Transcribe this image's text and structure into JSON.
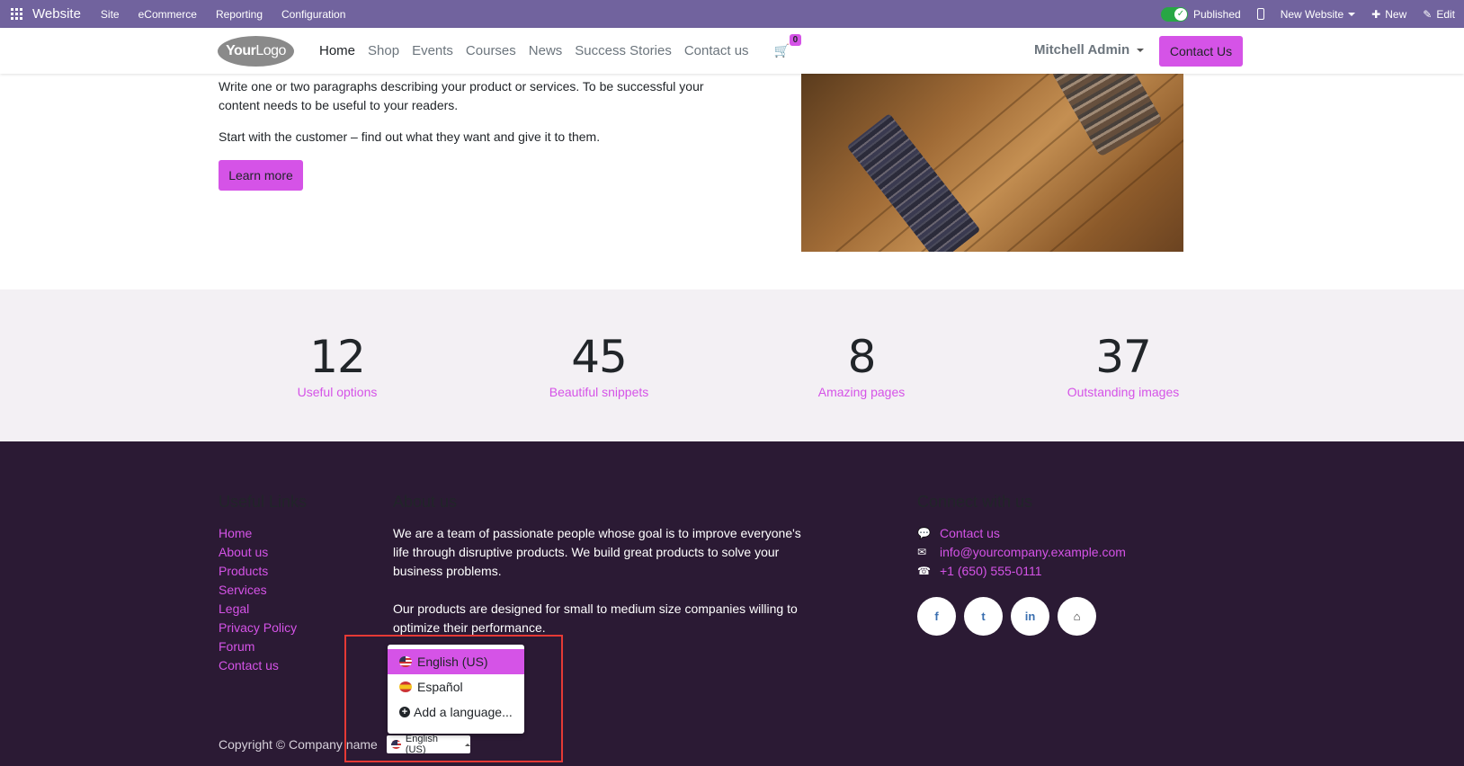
{
  "adminbar": {
    "brand": "Website",
    "menu": [
      "Site",
      "eCommerce",
      "Reporting",
      "Configuration"
    ],
    "published": "Published",
    "website": "New Website",
    "new": "New",
    "edit": "Edit"
  },
  "header": {
    "logo_bold": "Your",
    "logo_thin": "Logo",
    "nav": [
      "Home",
      "Shop",
      "Events",
      "Courses",
      "News",
      "Success Stories",
      "Contact us"
    ],
    "cart_count": "0",
    "user": "Mitchell Admin",
    "contact_btn": "Contact Us"
  },
  "content": {
    "para1": "Write one or two paragraphs describing your product or services. To be successful your content needs to be useful to your readers.",
    "para2": "Start with the customer – find out what they want and give it to them.",
    "learn_more": "Learn more"
  },
  "stats": [
    {
      "num": "12",
      "label": "Useful options"
    },
    {
      "num": "45",
      "label": "Beautiful snippets"
    },
    {
      "num": "8",
      "label": "Amazing pages"
    },
    {
      "num": "37",
      "label": "Outstanding images"
    }
  ],
  "footer": {
    "useful_links_title": "Useful Links",
    "links": [
      "Home",
      "About us",
      "Products",
      "Services",
      "Legal",
      "Privacy Policy",
      "Forum",
      "Contact us"
    ],
    "about_title": "About us",
    "about_p1": "We are a team of passionate people whose goal is to improve everyone's life through disruptive products. We build great products to solve your business problems.",
    "about_p2": "Our products are designed for small to medium size companies willing to optimize their performance.",
    "connect_title": "Connect with us",
    "contact_link": "Contact us",
    "email": "info@yourcompany.example.com",
    "phone": "+1 (650) 555-0111",
    "social": [
      "f",
      "t",
      "in",
      "⌂"
    ],
    "copyright": "Copyright © Company name",
    "lang_btn": "English (US)"
  },
  "lang_dropdown": {
    "items": [
      "English (US)",
      "Español"
    ],
    "add": "Add a language..."
  },
  "colors": {
    "adminbar": "#71639e",
    "primary": "#d553e7",
    "footer_bg": "#2b1a34",
    "stats_bg": "#f3f0f4",
    "highlight": "#e53935"
  }
}
